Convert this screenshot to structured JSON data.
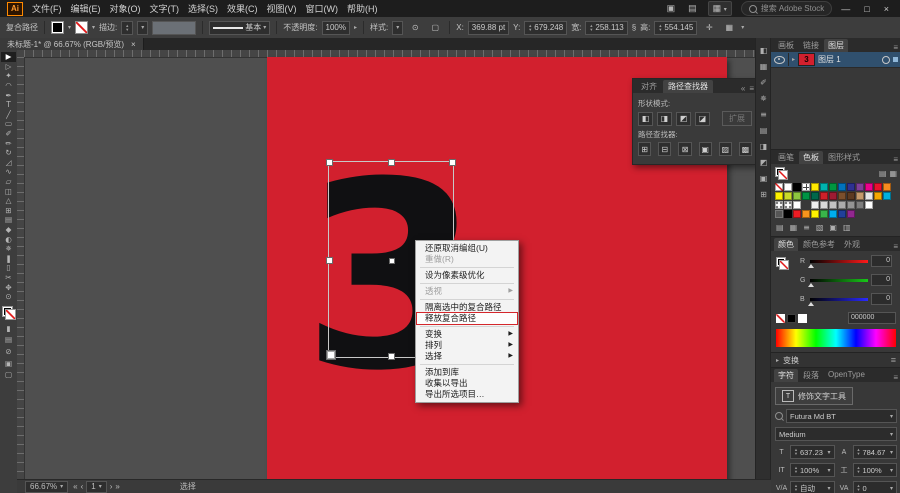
{
  "titlebar": {
    "logo": "Ai",
    "menus": [
      "文件(F)",
      "编辑(E)",
      "对象(O)",
      "文字(T)",
      "选择(S)",
      "效果(C)",
      "视图(V)",
      "窗口(W)",
      "帮助(H)"
    ],
    "workspace_icon": "▦",
    "share_icon": "▣",
    "layout_icon": "▤",
    "search_text": "搜索 Adobe Stock",
    "minimize": "—",
    "maximize": "□",
    "close": "×"
  },
  "control_bar": {
    "selection_label": "复合路径",
    "stroke_label": "描边:",
    "brush_name": "基本",
    "opacity_label": "不透明度:",
    "opacity_value": "100%",
    "style_label": "样式:",
    "recolor_icon": "⊙",
    "align_icon": "▢",
    "x_label": "X:",
    "x_value": "369.88 pt",
    "y_label": "Y:",
    "y_value": "679.248",
    "w_label": "宽:",
    "w_value": "258.113",
    "h_label": "高:",
    "h_value": "554.145",
    "link_icon": "§",
    "extra_icon1": "✛",
    "extra_icon2": "▦"
  },
  "document_tab": {
    "title": "未标题-1* @ 66.67% (RGB/预览)",
    "close": "×"
  },
  "toolbar": {
    "tools": [
      {
        "name": "selection-tool",
        "glyph": "▶",
        "active": true
      },
      {
        "name": "direct-selection-tool",
        "glyph": "▷"
      },
      {
        "name": "magic-wand-tool",
        "glyph": "✦"
      },
      {
        "name": "lasso-tool",
        "glyph": "◠"
      },
      {
        "name": "pen-tool",
        "glyph": "✒"
      },
      {
        "name": "type-tool",
        "glyph": "T"
      },
      {
        "name": "line-segment-tool",
        "glyph": "╱"
      },
      {
        "name": "rectangle-tool",
        "glyph": "▭"
      },
      {
        "name": "paintbrush-tool",
        "glyph": "✐"
      },
      {
        "name": "pencil-tool",
        "glyph": "✏"
      },
      {
        "name": "rotate-tool",
        "glyph": "↻"
      },
      {
        "name": "scale-tool",
        "glyph": "◿"
      },
      {
        "name": "width-tool",
        "glyph": "∿"
      },
      {
        "name": "free-transform-tool",
        "glyph": "▱"
      },
      {
        "name": "shape-builder-tool",
        "glyph": "◫"
      },
      {
        "name": "perspective-grid-tool",
        "glyph": "△"
      },
      {
        "name": "mesh-tool",
        "glyph": "⊞"
      },
      {
        "name": "gradient-tool",
        "glyph": "▤"
      },
      {
        "name": "eyedropper-tool",
        "glyph": "◆"
      },
      {
        "name": "blend-tool",
        "glyph": "◐"
      },
      {
        "name": "symbol-sprayer-tool",
        "glyph": "✵"
      },
      {
        "name": "column-graph-tool",
        "glyph": "❚"
      },
      {
        "name": "artboard-tool",
        "glyph": "▯"
      },
      {
        "name": "slice-tool",
        "glyph": "✂"
      },
      {
        "name": "hand-tool",
        "glyph": "✥"
      },
      {
        "name": "zoom-tool",
        "glyph": "⊙"
      }
    ],
    "bottom_icons": [
      {
        "name": "color-mode-icon",
        "glyph": "▮"
      },
      {
        "name": "gradient-mode-icon",
        "glyph": "▤"
      },
      {
        "name": "none-mode-icon",
        "glyph": "⊘"
      },
      {
        "name": "draw-mode-icon",
        "glyph": "▣"
      },
      {
        "name": "screen-mode-icon",
        "glyph": "▢"
      }
    ]
  },
  "canvas": {
    "artboard_color": "#d2202e",
    "glyph": "3"
  },
  "context_menu": {
    "items": [
      {
        "label": "还原取消编组(U)"
      },
      {
        "label": "重做(R)",
        "disabled": true,
        "sep_after": true
      },
      {
        "label": "设为像素级优化",
        "sep_after": true
      },
      {
        "label": "透视",
        "disabled": true,
        "submenu": true,
        "sep_after": true
      },
      {
        "label": "隔离选中的复合路径"
      },
      {
        "label": "释放复合路径",
        "highlight": true,
        "sep_after": true
      },
      {
        "label": "变换",
        "submenu": true
      },
      {
        "label": "排列",
        "submenu": true
      },
      {
        "label": "选择",
        "submenu": true,
        "sep_after": true
      },
      {
        "label": "添加到库"
      },
      {
        "label": "收集以导出"
      },
      {
        "label": "导出所选项目…"
      }
    ]
  },
  "pathfinder": {
    "tabs": [
      {
        "label": "对齐"
      },
      {
        "label": "路径查找器",
        "active": true
      }
    ],
    "collapse_icon": "«",
    "menu_icon": "≡",
    "shape_modes_label": "形状模式:",
    "shape_mode_icons": [
      {
        "name": "unite-icon",
        "glyph": "◧"
      },
      {
        "name": "minus-front-icon",
        "glyph": "◨"
      },
      {
        "name": "intersect-icon",
        "glyph": "◩"
      },
      {
        "name": "exclude-icon",
        "glyph": "◪"
      }
    ],
    "expand_label": "扩展",
    "pathfinders_label": "路径查找器:",
    "pathfinder_icons": [
      {
        "name": "divide-icon",
        "glyph": "⊞"
      },
      {
        "name": "trim-icon",
        "glyph": "⊟"
      },
      {
        "name": "merge-icon",
        "glyph": "⊠"
      },
      {
        "name": "crop-icon",
        "glyph": "▣"
      },
      {
        "name": "outline-icon",
        "glyph": "▨"
      },
      {
        "name": "minus-back-icon",
        "glyph": "▩"
      }
    ]
  },
  "dock": {
    "strip_icons": [
      {
        "name": "color-panel-icon",
        "glyph": "◧"
      },
      {
        "name": "swatches-panel-icon",
        "glyph": "▦"
      },
      {
        "name": "brushes-panel-icon",
        "glyph": "✐"
      },
      {
        "name": "symbols-panel-icon",
        "glyph": "✵"
      },
      {
        "name": "stroke-panel-icon",
        "glyph": "≡"
      },
      {
        "name": "gradient-panel-icon",
        "glyph": "▤"
      },
      {
        "name": "transparency-panel-icon",
        "glyph": "◨"
      },
      {
        "name": "appearance-panel-icon",
        "glyph": "◩"
      },
      {
        "name": "graphic-styles-panel-icon",
        "glyph": "▣"
      },
      {
        "name": "links-panel-icon",
        "glyph": "⊞"
      }
    ],
    "layers": {
      "tabs": [
        {
          "label": "画板"
        },
        {
          "label": "链接"
        },
        {
          "label": "图层",
          "active": true
        }
      ],
      "menu_icon": "≡",
      "thumb_glyph": "3",
      "layer_name": "图层 1"
    },
    "swatches": {
      "tabs": [
        {
          "label": "画笔"
        },
        {
          "label": "色板",
          "active": true
        },
        {
          "label": "图形样式"
        }
      ],
      "menu_icon": "≡",
      "list_view_icon": "▤",
      "grid_view_icon": "▦",
      "cells": [
        "none",
        "#ffffff",
        "#000000",
        "reg",
        "#ffe800",
        "#00b3b0",
        "#009640",
        "#0072bc",
        "#2e3192",
        "#7f3f98",
        "#ec008c",
        "#e8112d",
        "#f68b1f",
        "#fff200",
        "#cadb2a",
        "#8dc63f",
        "#009444",
        "#00674b",
        "#ce2029",
        "#9e1b32",
        "#7b4f2c",
        "#5c3a21",
        "#c49a6c",
        "#e6e7e8",
        "#f5a800",
        "#00b0dd",
        "pat",
        "pat",
        "#ffffff",
        "gap",
        "#f0f0f0",
        "#d9d9d9",
        "#c2c2c2",
        "#ababab",
        "#949494",
        "#7d7d7d",
        "#ffffff",
        "gap",
        "gap",
        "grp",
        "#000000",
        "#ed1c24",
        "#f7941d",
        "#fff200",
        "#39b54a",
        "#00aeef",
        "#21409a",
        "#92278f",
        "gap",
        "gap",
        "gap",
        "gap"
      ],
      "footer_icons": [
        {
          "name": "swatch-libraries-icon",
          "glyph": "▤"
        },
        {
          "name": "swatch-kinds-icon",
          "glyph": "▦"
        },
        {
          "name": "swatch-options-icon",
          "glyph": "≡"
        },
        {
          "name": "new-color-group-icon",
          "glyph": "▧"
        },
        {
          "name": "new-swatch-icon",
          "glyph": "▣"
        },
        {
          "name": "delete-swatch-icon",
          "glyph": "▥"
        }
      ]
    },
    "color": {
      "tabs": [
        {
          "label": "颜色",
          "active": true
        },
        {
          "label": "颜色参考"
        },
        {
          "label": "外观"
        }
      ],
      "menu_icon": "≡",
      "sliders": [
        {
          "label": "R",
          "color": "#ff1a1a",
          "value": "0"
        },
        {
          "label": "G",
          "color": "#18c818",
          "value": "0"
        },
        {
          "label": "B",
          "color": "#2a2aff",
          "value": "0"
        }
      ],
      "hex_value": "000000"
    },
    "transform_header": "变换",
    "transform_menu_icon": "≡",
    "character": {
      "tabs": [
        {
          "label": "字符",
          "active": true
        },
        {
          "label": "段落"
        },
        {
          "label": "OpenType"
        }
      ],
      "menu_icon": "≡",
      "touch_type_label": "修饰文字工具",
      "touch_type_icon": "T",
      "font_name": "Futura Md BT",
      "font_style": "Medium",
      "size_icon": "T",
      "size_value": "637.23",
      "leading_icon": "A",
      "leading_value": "784.67",
      "vscale_icon": "IT",
      "v_scale": "100%",
      "hscale_icon": "工",
      "h_scale": "100%",
      "kern_icon": "V/A",
      "kerning": "自动",
      "track_icon": "VA",
      "tracking": "0"
    }
  },
  "status_bar": {
    "zoom": "66.67%",
    "first": "«",
    "prev": "‹",
    "artboard": "1",
    "next": "›",
    "last": "»",
    "tool_label": "选择"
  }
}
